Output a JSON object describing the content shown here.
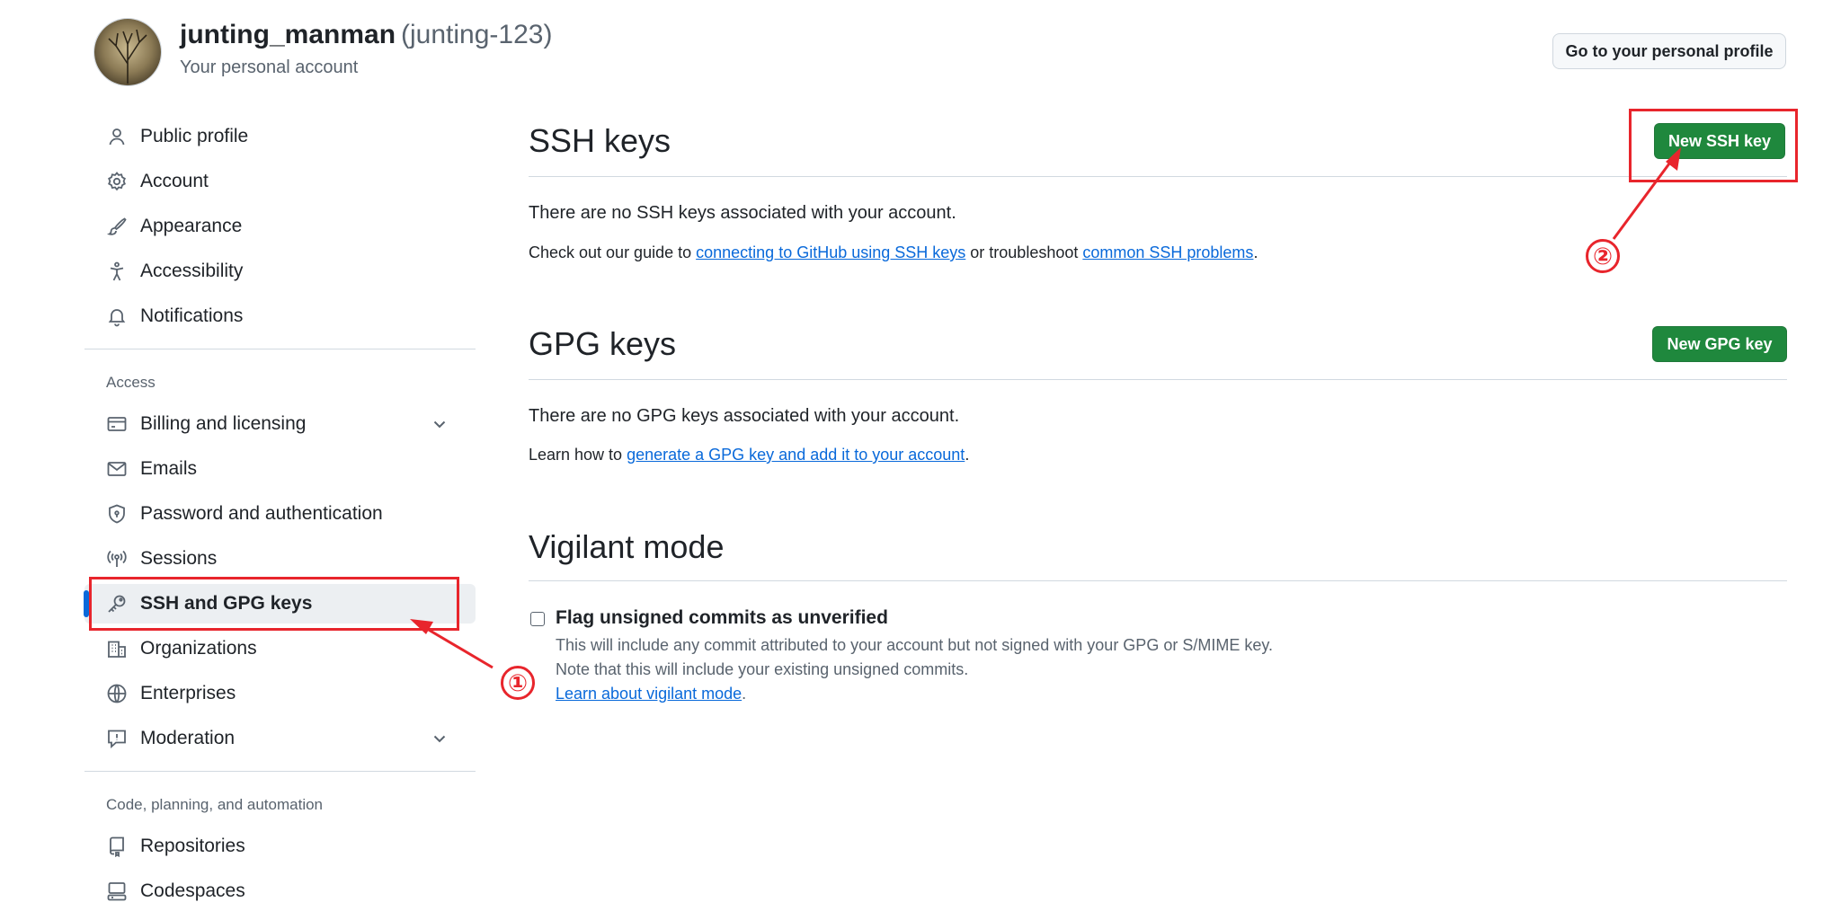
{
  "header": {
    "display_name": "junting_manman",
    "login": "(junting-123)",
    "subtitle": "Your personal account",
    "profile_button": "Go to your personal profile"
  },
  "sidebar": {
    "items_top": [
      {
        "label": "Public profile",
        "icon": "person-icon"
      },
      {
        "label": "Account",
        "icon": "gear-icon"
      },
      {
        "label": "Appearance",
        "icon": "paintbrush-icon"
      },
      {
        "label": "Accessibility",
        "icon": "accessibility-icon"
      },
      {
        "label": "Notifications",
        "icon": "bell-icon"
      }
    ],
    "access_heading": "Access",
    "items_access": [
      {
        "label": "Billing and licensing",
        "icon": "credit-card-icon"
      },
      {
        "label": "Emails",
        "icon": "mail-icon"
      },
      {
        "label": "Password and authentication",
        "icon": "shield-lock-icon"
      },
      {
        "label": "Sessions",
        "icon": "broadcast-icon"
      },
      {
        "label": "SSH and GPG keys",
        "icon": "key-icon"
      },
      {
        "label": "Organizations",
        "icon": "organization-icon"
      },
      {
        "label": "Enterprises",
        "icon": "globe-icon"
      },
      {
        "label": "Moderation",
        "icon": "report-icon"
      }
    ],
    "code_heading": "Code, planning, and automation",
    "items_code": [
      {
        "label": "Repositories",
        "icon": "repo-icon"
      },
      {
        "label": "Codespaces",
        "icon": "codespaces-icon"
      }
    ]
  },
  "ssh": {
    "title": "SSH keys",
    "button": "New SSH key",
    "empty": "There are no SSH keys associated with your account.",
    "help_prefix": "Check out our guide to ",
    "help_link1": "connecting to GitHub using SSH keys",
    "help_middle": " or troubleshoot ",
    "help_link2": "common SSH problems",
    "help_suffix": "."
  },
  "gpg": {
    "title": "GPG keys",
    "button": "New GPG key",
    "empty": "There are no GPG keys associated with your account.",
    "help_prefix": "Learn how to ",
    "help_link": "generate a GPG key and add it to your account",
    "help_suffix": "."
  },
  "vigilant": {
    "title": "Vigilant mode",
    "checkbox_label": "Flag unsigned commits as unverified",
    "checked": false,
    "note1": "This will include any commit attributed to your account but not signed with your GPG or S/MIME key.",
    "note2": "Note that this will include your existing unsigned commits.",
    "link": "Learn about vigilant mode",
    "link_suffix": "."
  },
  "annotations": {
    "step1": "①",
    "step2": "②",
    "color": "#e8252c"
  },
  "colors": {
    "accent": "#0969da",
    "primary_button": "#1f883d",
    "annotation": "#e8252c"
  }
}
